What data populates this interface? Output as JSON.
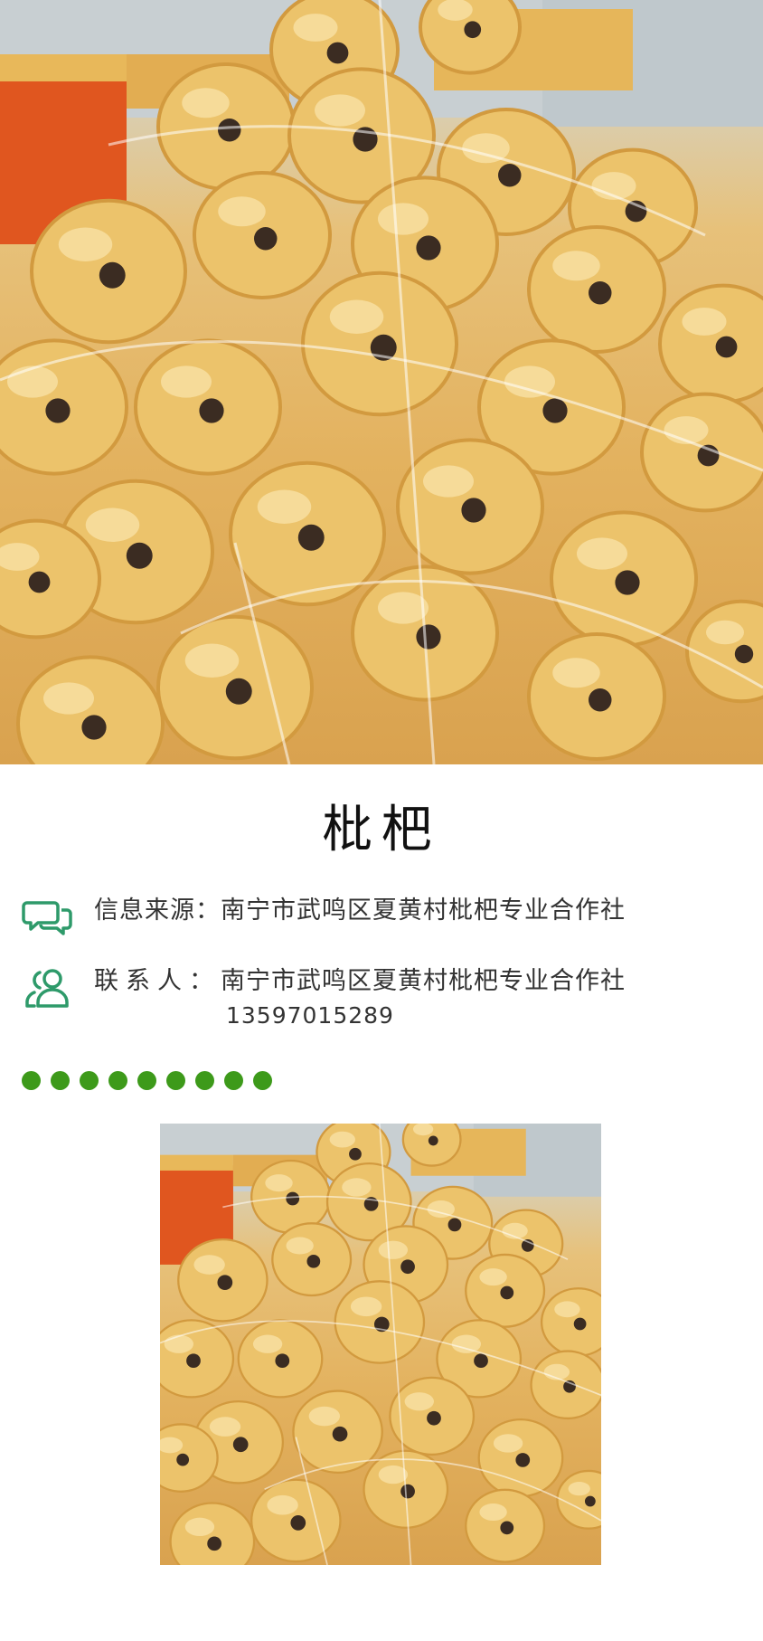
{
  "hero_image": {
    "alt_icon": "loquat-photo",
    "colors": {
      "fruit": "#ecc36b",
      "fruit_shadow": "#d29a3f",
      "calyx": "#3b2c22",
      "bucket": "#e0561f",
      "bg": "#c9d2d6"
    }
  },
  "product": {
    "title": "枇杷"
  },
  "info": {
    "source_label": "信息来源：",
    "source_value": "南宁市武鸣区夏黄村枇杷专业合作社",
    "contact_label": "联系人：",
    "contact_value": "南宁市武鸣区夏黄村枇杷专业合作社",
    "contact_phone": "13597015289",
    "icon_color": "#2e9a6a"
  },
  "divider": {
    "dot_count": 9,
    "dot_color": "#3d9a1a"
  },
  "detail_image": {
    "alt_icon": "loquat-photo"
  }
}
